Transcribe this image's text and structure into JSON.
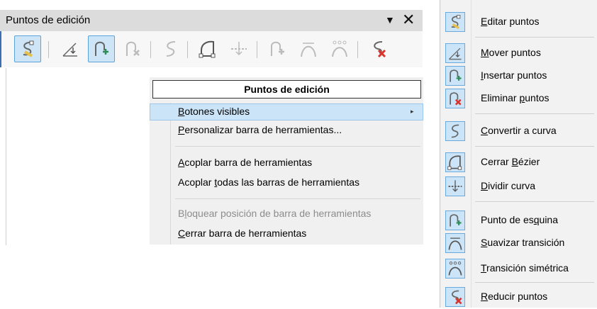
{
  "toolbar": {
    "title": "Puntos de edición",
    "menu_arrow": "▼",
    "close": "✕",
    "buttons": [
      {
        "name": "edit-points",
        "active": true
      },
      {
        "name": "move-points",
        "active": false
      },
      {
        "name": "insert-points",
        "active": true
      },
      {
        "name": "delete-points",
        "active": false
      },
      {
        "name": "convert-to-curve",
        "active": false
      },
      {
        "name": "close-bezier",
        "active": false
      },
      {
        "name": "split-curve",
        "active": false
      },
      {
        "name": "corner-point",
        "active": false
      },
      {
        "name": "smooth-transition",
        "active": false
      },
      {
        "name": "symmetric-transition",
        "active": false
      },
      {
        "name": "eliminate-points",
        "active": false
      }
    ]
  },
  "context_menu": {
    "title": "Puntos de edición",
    "items": [
      {
        "pre": "",
        "key": "B",
        "post": "otones visibles",
        "submenu": true,
        "highlighted": true,
        "disabled": false
      },
      {
        "pre": "",
        "key": "P",
        "post": "ersonalizar barra de herramientas...",
        "submenu": false,
        "highlighted": false,
        "disabled": false
      },
      {
        "pre": "",
        "key": "A",
        "post": "coplar barra de herramientas",
        "submenu": false,
        "highlighted": false,
        "disabled": false
      },
      {
        "pre": "Acoplar ",
        "key": "t",
        "post": "odas las barras de herramientas",
        "submenu": false,
        "highlighted": false,
        "disabled": false
      },
      {
        "pre": "B",
        "key": "l",
        "post": "oquear posición de barra de herramientas",
        "submenu": false,
        "highlighted": false,
        "disabled": true
      },
      {
        "pre": "",
        "key": "C",
        "post": "errar barra de herramientas",
        "submenu": false,
        "highlighted": false,
        "disabled": false
      }
    ],
    "submenu_arrow": "▸"
  },
  "buttons_menu": {
    "items": [
      {
        "pre": "",
        "key": "E",
        "post": "ditar puntos",
        "icon": "edit-points-icon"
      },
      {
        "pre": "",
        "key": "M",
        "post": "over puntos",
        "icon": "move-points-icon"
      },
      {
        "pre": "",
        "key": "I",
        "post": "nsertar puntos",
        "icon": "insert-points-icon"
      },
      {
        "pre": "Eliminar ",
        "key": "p",
        "post": "untos",
        "icon": "delete-points-icon"
      },
      {
        "pre": "",
        "key": "C",
        "post": "onvertir a curva",
        "icon": "convert-to-curve-icon"
      },
      {
        "pre": "Cerrar ",
        "key": "B",
        "post": "ézier",
        "icon": "close-bezier-icon"
      },
      {
        "pre": "",
        "key": "D",
        "post": "ividir curva",
        "icon": "split-curve-icon"
      },
      {
        "pre": "Punto de es",
        "key": "q",
        "post": "uina",
        "icon": "corner-point-icon"
      },
      {
        "pre": "",
        "key": "S",
        "post": "uavizar transición",
        "icon": "smooth-transition-icon"
      },
      {
        "pre": "",
        "key": "T",
        "post": "ransición simétrica",
        "icon": "symmetric-transition-icon"
      },
      {
        "pre": "",
        "key": "R",
        "post": "educir puntos",
        "icon": "eliminate-points-icon"
      }
    ]
  },
  "colors": {
    "accent": "#3b6fb5",
    "highlight": "#cce4f7",
    "icon_border": "#6aa9dc",
    "delete_red": "#d9332b",
    "icon_green": "#2e8b57",
    "icon_yellow": "#e6c04a"
  }
}
